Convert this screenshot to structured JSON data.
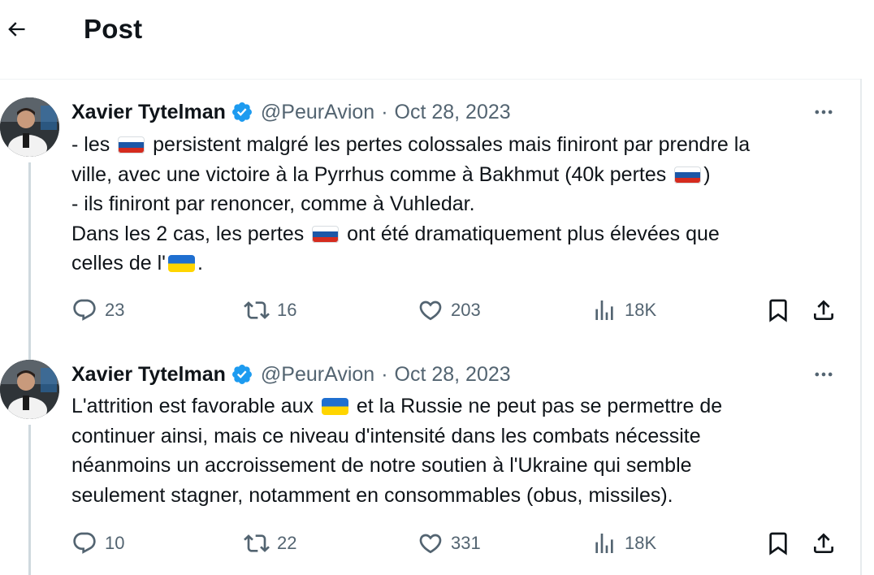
{
  "header": {
    "title": "Post"
  },
  "tweets": [
    {
      "author": {
        "name": "Xavier Tytelman",
        "handle": "@PeurAvion"
      },
      "date": "Oct 28, 2023",
      "text_lines": [
        [
          "- les",
          "persistent malgré les pertes colossales mais finiront par prendre la"
        ],
        [
          "ville, avec une victoire à la Pyrrhus comme à Bakhmut (40k pertes",
          ")"
        ],
        [
          "- ils finiront par renoncer, comme à Vuhledar."
        ],
        [
          "Dans les 2 cas, les pertes",
          "ont été dramatiquement plus élevées que"
        ],
        [
          "celles de l'",
          "."
        ]
      ],
      "flags": [
        "russia-flag",
        "russia-flag",
        "russia-flag",
        "ukraine-flag"
      ],
      "stats": {
        "replies": "23",
        "reposts": "16",
        "likes": "203",
        "views": "18K"
      }
    },
    {
      "author": {
        "name": "Xavier Tytelman",
        "handle": "@PeurAvion"
      },
      "date": "Oct 28, 2023",
      "text_lines": [
        [
          "L'attrition est favorable aux",
          "et la Russie ne peut pas se permettre de"
        ],
        [
          "continuer ainsi, mais ce niveau d'intensité dans les combats nécessite"
        ],
        [
          "néanmoins un accroissement de notre soutien à l'Ukraine qui semble"
        ],
        [
          "seulement stagner, notamment en consommables (obus, missiles)."
        ]
      ],
      "flags": [
        "ukraine-flag"
      ],
      "stats": {
        "replies": "10",
        "reposts": "22",
        "likes": "331",
        "views": "18K"
      }
    }
  ],
  "colors": {
    "accent": "#1d9bf0",
    "secondary_text": "#536471",
    "thread_line": "#cfd9de"
  },
  "icons": [
    "back-arrow-icon",
    "verified-badge-icon",
    "more-icon",
    "reply-icon",
    "repost-icon",
    "like-icon",
    "views-icon",
    "bookmark-icon",
    "share-icon"
  ]
}
